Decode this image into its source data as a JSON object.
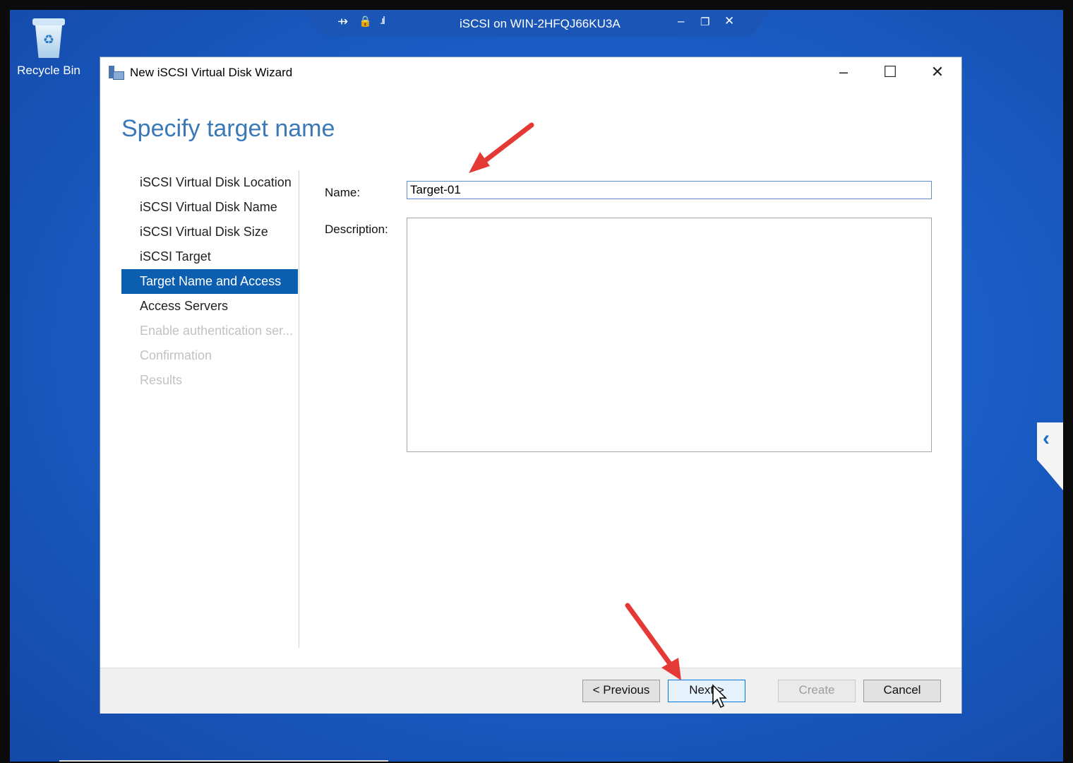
{
  "desktop": {
    "recycle_bin_label": "Recycle Bin"
  },
  "remote_bar": {
    "title": "iSCSI on WIN-2HFQJ66KU3A",
    "pin_icon": "pin-icon",
    "lock_icon": "lock-icon",
    "signal_icon": "signal-icon",
    "minimize_symbol": "–",
    "restore_symbol": "❐",
    "close_symbol": "✕"
  },
  "window": {
    "title": "New iSCSI Virtual Disk Wizard",
    "minimize_symbol": "–",
    "maximize_symbol": "☐",
    "close_symbol": "✕"
  },
  "page": {
    "heading": "Specify target name"
  },
  "steps": [
    {
      "label": "iSCSI Virtual Disk Location",
      "state": "normal"
    },
    {
      "label": "iSCSI Virtual Disk Name",
      "state": "normal"
    },
    {
      "label": "iSCSI Virtual Disk Size",
      "state": "normal"
    },
    {
      "label": "iSCSI Target",
      "state": "normal"
    },
    {
      "label": "Target Name and Access",
      "state": "selected"
    },
    {
      "label": "Access Servers",
      "state": "normal"
    },
    {
      "label": "Enable authentication ser...",
      "state": "disabled"
    },
    {
      "label": "Confirmation",
      "state": "disabled"
    },
    {
      "label": "Results",
      "state": "disabled"
    }
  ],
  "form": {
    "name_label": "Name:",
    "name_value": "Target-01",
    "description_label": "Description:",
    "description_value": ""
  },
  "buttons": {
    "previous": "< Previous",
    "next": "Next >",
    "create": "Create",
    "cancel": "Cancel"
  },
  "colors": {
    "accent": "#0c5fb0",
    "heading": "#3a78b8",
    "annotation_arrow": "#e53935"
  }
}
